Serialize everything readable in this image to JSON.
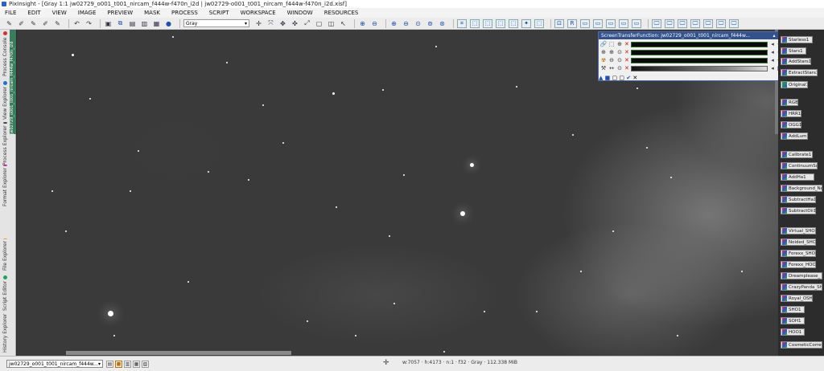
{
  "window": {
    "title": "PixInsight - [Gray 1:1 jw02729_o001_t001_nircam_f444w-f470n_i2d | jw02729-o001_t001_nircam_f444w-f470n_i2d.xisf]"
  },
  "menu": [
    "FILE",
    "EDIT",
    "VIEW",
    "IMAGE",
    "PREVIEW",
    "MASK",
    "PROCESS",
    "SCRIPT",
    "WORKSPACE",
    "WINDOW",
    "RESOURCES"
  ],
  "toolbar": {
    "display_mode": "Gray"
  },
  "left_tabs": [
    {
      "label": "Process Console",
      "color": "#d03030"
    },
    {
      "label": "View Explorer",
      "color": "#2070d0"
    },
    {
      "label": "Process Explorer",
      "color": "#404040"
    },
    {
      "label": "Format Explorer",
      "color": "#c030a0"
    },
    {
      "label": "File Explorer",
      "color": "#e0a020"
    },
    {
      "label": "Script Editor",
      "color": "#20a060"
    },
    {
      "label": "History Explorer",
      "color": "#c06020"
    }
  ],
  "image_tab_label": "jw02729_o001_t001_nircam_f444w_f470n_i2d",
  "stf": {
    "title": "ScreenTransferFunction: jw02729_o001_t001_nircam_f444w..."
  },
  "icons": [
    {
      "label": "Starless1",
      "type": "pm"
    },
    {
      "label": "Stars1",
      "type": "pm"
    },
    {
      "label": "AddStars1",
      "type": "pm"
    },
    {
      "label": "ExtractStars1",
      "type": "pm"
    },
    {
      "label": "Original1",
      "type": "img"
    },
    {
      "label": "RGB1",
      "type": "pm"
    },
    {
      "label": "HRR1",
      "type": "pm"
    },
    {
      "label": "OGG1",
      "type": "pm"
    },
    {
      "label": "AddLum1",
      "type": "pm"
    },
    {
      "label": "Calibrate1",
      "type": "pm"
    },
    {
      "label": "ContinuumSub1",
      "type": "pm"
    },
    {
      "label": "AddHa1",
      "type": "pm"
    },
    {
      "label": "Background_Ne",
      "type": "pm"
    },
    {
      "label": "SubtractHa1",
      "type": "pm"
    },
    {
      "label": "SubtractOii1",
      "type": "pm"
    },
    {
      "label": "Virtual_SHO11",
      "type": "pm"
    },
    {
      "label": "Noided_SHO1",
      "type": "pm"
    },
    {
      "label": "Forexx_SHO1",
      "type": "pm"
    },
    {
      "label": "Forexx_HOO1",
      "type": "pm"
    },
    {
      "label": "Dreamplease_",
      "type": "pm"
    },
    {
      "label": "CrazyPanda_SH",
      "type": "pm"
    },
    {
      "label": "Royal_OSH1",
      "type": "pm"
    },
    {
      "label": "SHO1",
      "type": "pm"
    },
    {
      "label": "SOH1",
      "type": "pm"
    },
    {
      "label": "HOO1",
      "type": "pm"
    },
    {
      "label": "CosmeticCorrec",
      "type": "pm"
    }
  ],
  "statusbar": {
    "view": "jw02729_o001_t001_nircam_f444w...",
    "info": "w:7057  ·  h:4173  ·  n:1  ·  f32  ·  Gray  ·  112.338 MiB"
  }
}
